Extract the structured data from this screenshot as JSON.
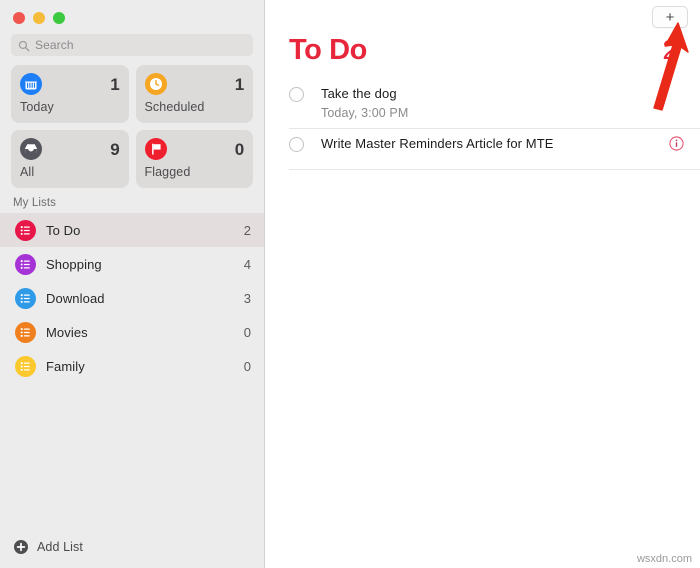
{
  "window": {
    "traffic_lights": [
      {
        "name": "close",
        "color": "#f0564f"
      },
      {
        "name": "minimize",
        "color": "#f5bc3c"
      },
      {
        "name": "maximize",
        "color": "#3dc93f"
      }
    ]
  },
  "sidebar": {
    "search": {
      "placeholder": "Search",
      "value": "",
      "icon": "search-icon"
    },
    "smart_cards": [
      {
        "label": "Today",
        "count": "1",
        "icon": "calendar-icon",
        "color": "#1d7ef5"
      },
      {
        "label": "Scheduled",
        "count": "1",
        "icon": "clock-icon",
        "color": "#f5a623"
      },
      {
        "label": "All",
        "count": "9",
        "icon": "inbox-icon",
        "color": "#5a5a62"
      },
      {
        "label": "Flagged",
        "count": "0",
        "icon": "flag-icon",
        "color": "#f01f2e"
      }
    ],
    "mylists_header": "My Lists",
    "lists": [
      {
        "name": "To Do",
        "count": "2",
        "color": "#e8174a",
        "selected": true
      },
      {
        "name": "Shopping",
        "count": "4",
        "color": "#a633d6",
        "selected": false
      },
      {
        "name": "Download",
        "count": "3",
        "color": "#2f9ae8",
        "selected": false
      },
      {
        "name": "Movies",
        "count": "0",
        "color": "#f0801f",
        "selected": false
      },
      {
        "name": "Family",
        "count": "0",
        "color": "#fbc82e",
        "selected": false
      }
    ],
    "add_list": {
      "label": "Add List",
      "icon": "plus-circle-icon"
    }
  },
  "main": {
    "add_button": {
      "label": "+",
      "icon": "plus-icon"
    },
    "title": "To Do",
    "title_color": "#e8263b",
    "count": "2",
    "reminders": [
      {
        "title": "Take the dog",
        "subtitle": "Today, 3:00 PM",
        "completed": false,
        "has_info": false
      },
      {
        "title": "Write Master Reminders Article for MTE",
        "subtitle": "",
        "completed": false,
        "has_info": true,
        "info_icon": "info-circle-icon"
      }
    ]
  },
  "annotation": {
    "arrow": {
      "name": "red-arrow-annotation",
      "color": "#e8281c"
    }
  },
  "watermark": {
    "text": "wsxdn.com"
  }
}
